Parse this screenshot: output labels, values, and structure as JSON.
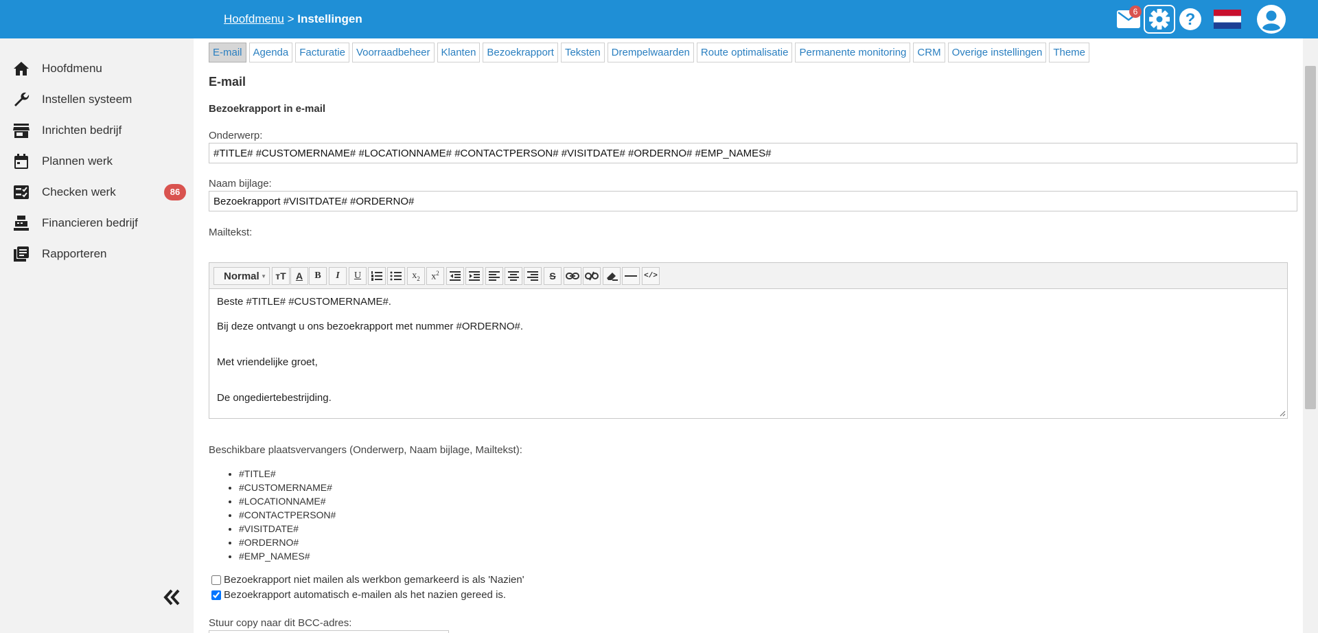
{
  "header": {
    "breadcrumb_link": "Hoofdmenu",
    "breadcrumb_sep": " > ",
    "breadcrumb_current": "Instellingen",
    "mail_count": "6",
    "colors": {
      "bar": "#1f8fd6",
      "badge": "#d9534f"
    },
    "icons": [
      "mail-icon",
      "gear-icon",
      "help-icon",
      "flag-nl-icon",
      "user-avatar-icon"
    ]
  },
  "sidebar": {
    "items": [
      {
        "label": "Hoofdmenu",
        "icon": "home-icon"
      },
      {
        "label": "Instellen systeem",
        "icon": "wrench-icon"
      },
      {
        "label": "Inrichten bedrijf",
        "icon": "store-icon"
      },
      {
        "label": "Plannen werk",
        "icon": "calendar-icon"
      },
      {
        "label": "Checken werk",
        "icon": "checklist-icon",
        "badge": "86"
      },
      {
        "label": "Financieren bedrijf",
        "icon": "cash-register-icon"
      },
      {
        "label": "Rapporteren",
        "icon": "report-icon"
      }
    ],
    "collapse_icon": "double-chevron-left-icon"
  },
  "tabs": [
    {
      "label": "E-mail",
      "active": true
    },
    {
      "label": "Agenda"
    },
    {
      "label": "Facturatie"
    },
    {
      "label": "Voorraadbeheer"
    },
    {
      "label": "Klanten"
    },
    {
      "label": "Bezoekrapport"
    },
    {
      "label": "Teksten"
    },
    {
      "label": "Drempelwaarden"
    },
    {
      "label": "Route optimalisatie"
    },
    {
      "label": "Permanente monitoring"
    },
    {
      "label": "CRM"
    },
    {
      "label": "Overige instellingen"
    },
    {
      "label": "Theme"
    }
  ],
  "content": {
    "section_title": "E-mail",
    "subsection_title": "Bezoekrapport in e-mail",
    "subject_label": "Onderwerp:",
    "subject_value": "#TITLE# #CUSTOMERNAME# #LOCATIONNAME# #CONTACTPERSON# #VISITDATE# #ORDERNO# #EMP_NAMES#",
    "attachment_label": "Naam bijlage:",
    "attachment_value": "Bezoekrapport #VISITDATE# #ORDERNO#",
    "mailtext_label": "Mailtekst:",
    "editor": {
      "format_label": "Normal",
      "lines": [
        "Beste #TITLE# #CUSTOMERNAME#.",
        "Bij deze ontvangt u ons bezoekrapport met nummer #ORDERNO#.",
        "Met vriendelijke groet,",
        "De ongediertebestrijding."
      ]
    },
    "placeholders_label": "Beschikbare plaatsvervangers (Onderwerp, Naam bijlage, Mailtekst):",
    "placeholders": [
      "#TITLE#",
      "#CUSTOMERNAME#",
      "#LOCATIONNAME#",
      "#CONTACTPERSON#",
      "#VISITDATE#",
      "#ORDERNO#",
      "#EMP_NAMES#"
    ],
    "checkbox_no_mail_label": "Bezoekrapport niet mailen als werkbon gemarkeerd is als 'Nazien'",
    "checkbox_no_mail_checked": false,
    "checkbox_auto_mail_label": "Bezoekrapport automatisch e-mailen als het nazien gereed is.",
    "checkbox_auto_mail_checked": true,
    "bcc_label": "Stuur copy naar dit BCC-adres:"
  }
}
